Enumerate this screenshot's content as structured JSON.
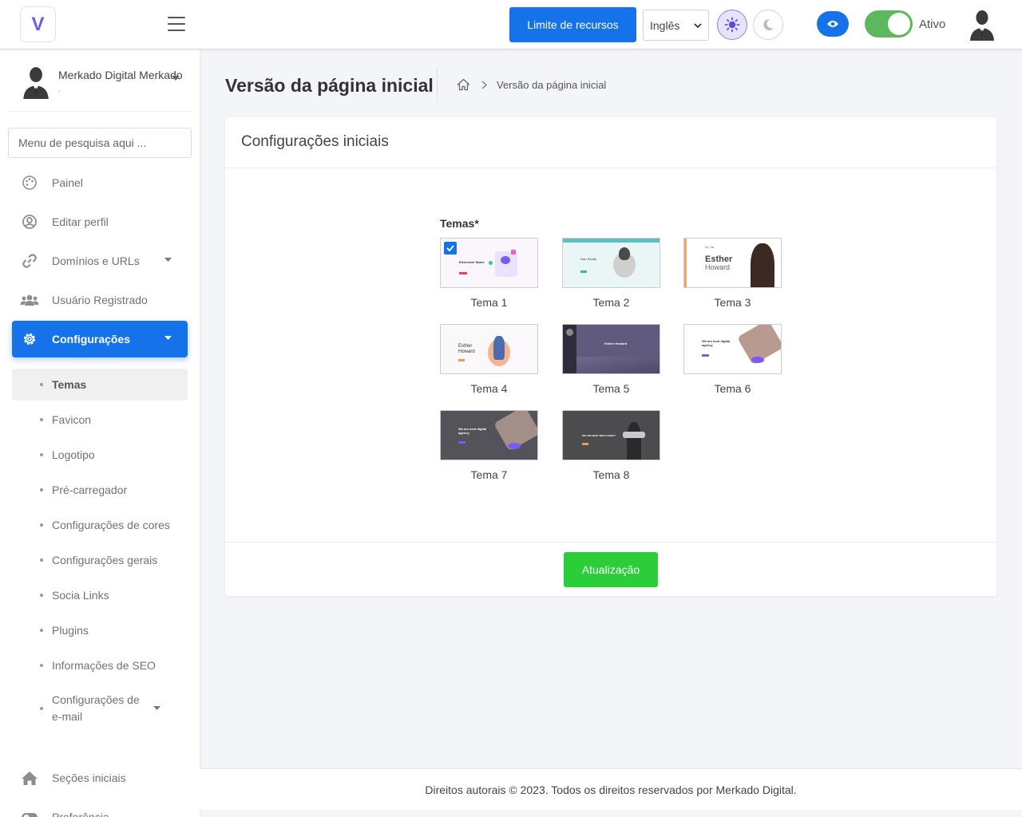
{
  "topbar": {
    "logo_letter": "V",
    "limit_button": "Limite de recursos",
    "language": "Inglês",
    "status_label": "Ativo",
    "colors": {
      "primary": "#1572e8",
      "toggle": "#5cb85c"
    }
  },
  "sidebar": {
    "user_name": "Merkado Digital Merkado",
    "user_sub": ".",
    "search_placeholder": "Menu de pesquisa aqui ...",
    "items": [
      {
        "label": "Painel",
        "icon": "palette-icon"
      },
      {
        "label": "Editar perfil",
        "icon": "user-circle-icon"
      },
      {
        "label": "Domínios e URLs",
        "icon": "link-icon"
      },
      {
        "label": "Usuário Registrado",
        "icon": "users-icon"
      },
      {
        "label": "Configurações",
        "icon": "gear-icon"
      }
    ],
    "subitems": [
      {
        "label": "Temas"
      },
      {
        "label": "Favicon"
      },
      {
        "label": "Logotipo"
      },
      {
        "label": "Pré-carregador"
      },
      {
        "label": "Configurações de cores"
      },
      {
        "label": "Configurações gerais"
      },
      {
        "label": "Socia Links"
      },
      {
        "label": "Plugins"
      },
      {
        "label": "Informações de SEO"
      },
      {
        "label": "Configurações de e-mail"
      }
    ],
    "bottom_items": [
      {
        "label": "Seções iniciais",
        "icon": "home-icon"
      },
      {
        "label": "Preferência",
        "icon": "toggle-icon"
      }
    ]
  },
  "main": {
    "title": "Versão da página inicial",
    "breadcrumb": "Versão da página inicial",
    "card_title": "Configurações iniciais",
    "themes_label": "Temas*",
    "themes": [
      {
        "name": "Tema 1",
        "selected": true
      },
      {
        "name": "Tema 2",
        "selected": false
      },
      {
        "name": "Tema 3",
        "selected": false
      },
      {
        "name": "Tema 4",
        "selected": false
      },
      {
        "name": "Tema 5",
        "selected": false
      },
      {
        "name": "Tema 6",
        "selected": false
      },
      {
        "name": "Tema 7",
        "selected": false
      },
      {
        "name": "Tema 8",
        "selected": false
      }
    ],
    "thumb_text": {
      "t1": "Elementor Name",
      "t2": "Ivan Sandy",
      "t3_small": "Hi, I'm",
      "t3_a": "Esther",
      "t3_b": "Howard",
      "t4_a": "Esther",
      "t4_b": "Howard",
      "t5": "Esther Howard",
      "t6": "We are best digital agency",
      "t7": "We are best digital agency",
      "t8": "WE ARE BEST WEB AGENCY"
    },
    "update_button": "Atualização"
  },
  "footer": {
    "text": "Direitos autorais © 2023. Todos os direitos reservados por Merkado Digital."
  }
}
